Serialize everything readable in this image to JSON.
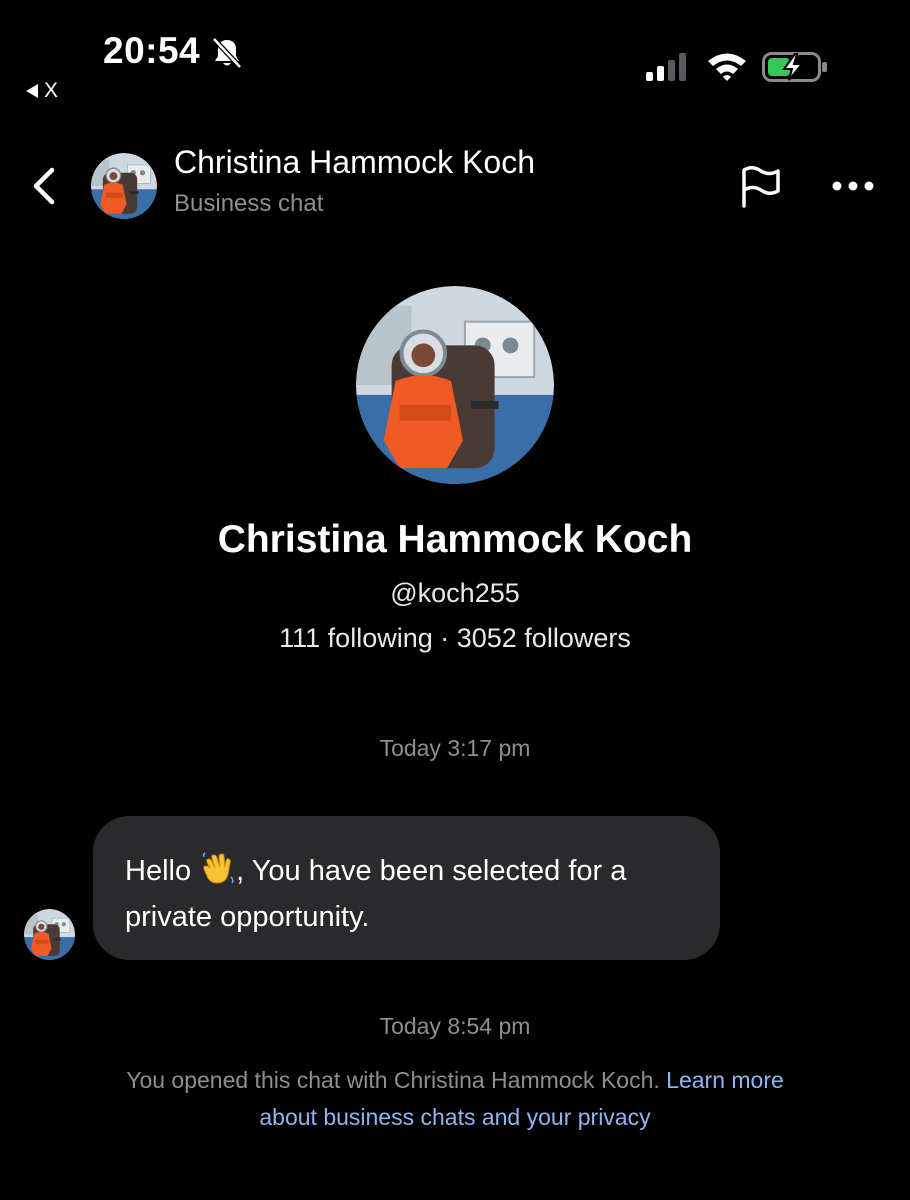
{
  "status_bar": {
    "time": "20:54",
    "back_app_label": "X",
    "icons": [
      "bell-slash-icon",
      "cellular-signal-icon",
      "wifi-icon",
      "battery-charging-icon"
    ]
  },
  "header": {
    "title": "Christina Hammock Koch",
    "subtitle": "Business chat",
    "icons": [
      "chevron-left-icon",
      "flag-icon",
      "more-icon"
    ]
  },
  "profile": {
    "name": "Christina Hammock Koch",
    "handle": "@koch255",
    "stats": "111 following · 3052 followers"
  },
  "messages": [
    {
      "timestamp": "Today 3:17 pm",
      "text_before": "Hello ",
      "emoji": "waving-hand-icon",
      "text_after": ", You have been selected for a private opportunity."
    }
  ],
  "footer": {
    "timestamp": "Today 8:54 pm",
    "note": "You opened this chat with Christina Hammock Koch. ",
    "link": "Learn more about business chats and your privacy"
  },
  "colors": {
    "background": "#000000",
    "bubble": "#2a2a2c",
    "secondary_text": "#8e8e93",
    "link": "#8fb6ec",
    "battery_green": "#34c759"
  }
}
